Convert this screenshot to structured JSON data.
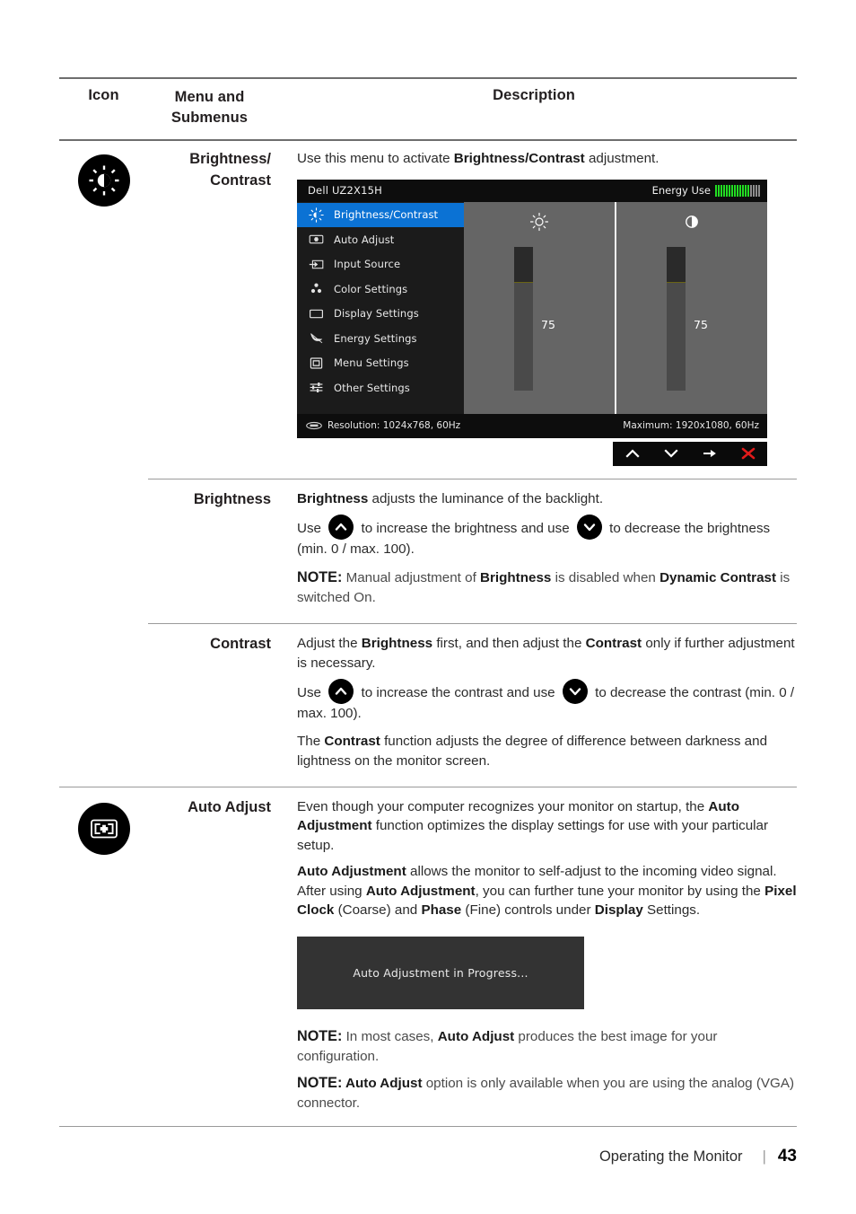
{
  "header": {
    "col_icon": "Icon",
    "col_menu_line1": "Menu and",
    "col_menu_line2": "Submenus",
    "col_desc": "Description"
  },
  "rows": {
    "brightness_contrast": {
      "icon_name": "brightness-contrast-icon",
      "label_line1": "Brightness/",
      "label_line2": "Contrast",
      "intro_pre": "Use this menu to activate ",
      "intro_bold": "Brightness/Contrast",
      "intro_post": " adjustment."
    },
    "brightness": {
      "label": "Brightness",
      "p1_bold": "Brightness",
      "p1_rest": " adjusts the luminance of the backlight.",
      "p2_use": "Use",
      "p2_mid": "to increase the brightness and use",
      "p2_end": "to decrease the brightness (min. 0 / max. 100).",
      "note_label": "NOTE:",
      "note_a": " Manual adjustment of ",
      "note_b1": "Brightness",
      "note_c": " is disabled when ",
      "note_b2": "Dynamic Contrast",
      "note_d": " is switched On."
    },
    "contrast": {
      "label": "Contrast",
      "p1_a": "Adjust the ",
      "p1_b1": "Brightness",
      "p1_c": " first, and then adjust the ",
      "p1_b2": "Contrast",
      "p1_d": " only if further adjustment is necessary.",
      "p2_use": "Use",
      "p2_mid": "to increase the contrast and use",
      "p2_end": "to decrease the contrast (min. 0 / max. 100).",
      "p3_a": "The ",
      "p3_b": "Contrast",
      "p3_c": " function adjusts the degree of difference between darkness and lightness on the monitor screen."
    },
    "auto_adjust": {
      "icon_name": "auto-adjust-icon",
      "label": "Auto Adjust",
      "p1_a": "Even though your computer recognizes your monitor on startup, the ",
      "p1_b": "Auto Adjustment",
      "p1_c": " function optimizes the display settings for use with your particular setup.",
      "p2_b1": "Auto Adjustment",
      "p2_a": " allows the monitor to self-adjust to the incoming video signal. After using ",
      "p2_b2": "Auto Adjustment",
      "p2_c": ", you can further tune your monitor by using the ",
      "p2_b3": "Pixel Clock",
      "p2_d": " (Coarse) and ",
      "p2_b4": "Phase",
      "p2_e": " (Fine) controls under ",
      "p2_b5": "Display",
      "p2_f": " Settings.",
      "progress_text": "Auto Adjustment  in Progress...",
      "note1_label": "NOTE:",
      "note1_a": " In most cases, ",
      "note1_b": "Auto Adjust",
      "note1_c": " produces the best image for your configuration.",
      "note2_label": "NOTE:",
      "note2_b": " Auto Adjust",
      "note2_c": " option is only available when you are using the analog (VGA) connector."
    }
  },
  "osd": {
    "model": "Dell UZ2X15H",
    "energy_label": "Energy Use",
    "energy_bars_on": 13,
    "energy_bars_off": 4,
    "menu_items": [
      {
        "label": "Brightness/Contrast",
        "icon": "sun-brightness-icon",
        "selected": true
      },
      {
        "label": "Auto Adjust",
        "icon": "auto-adjust-box-icon",
        "selected": false
      },
      {
        "label": "Input Source",
        "icon": "input-source-arrow-icon",
        "selected": false
      },
      {
        "label": "Color Settings",
        "icon": "color-dots-icon",
        "selected": false
      },
      {
        "label": "Display Settings",
        "icon": "display-rect-icon",
        "selected": false
      },
      {
        "label": "Energy Settings",
        "icon": "energy-leaf-icon",
        "selected": false
      },
      {
        "label": "Menu Settings",
        "icon": "menu-panel-icon",
        "selected": false
      },
      {
        "label": "Other Settings",
        "icon": "sliders-icon",
        "selected": false
      }
    ],
    "brightness_value": "75",
    "contrast_value": "75",
    "brightness_icon": "sun-icon",
    "contrast_icon": "half-circle-contrast-icon",
    "resolution": "Resolution: 1024x768, 60Hz",
    "maximum": "Maximum: 1920x1080, 60Hz",
    "nav": [
      {
        "name": "nav-up-button",
        "glyph": "up-chevron-icon"
      },
      {
        "name": "nav-down-button",
        "glyph": "down-chevron-icon"
      },
      {
        "name": "nav-enter-button",
        "glyph": "right-arrow-icon"
      },
      {
        "name": "nav-exit-button",
        "glyph": "close-x-icon"
      }
    ],
    "accent_blue": "#0b72d4",
    "energy_green": "#22dd22",
    "exit_red": "#e01b1b"
  },
  "footer": {
    "chapter": "Operating the Monitor",
    "separator": "|",
    "page": "43"
  }
}
